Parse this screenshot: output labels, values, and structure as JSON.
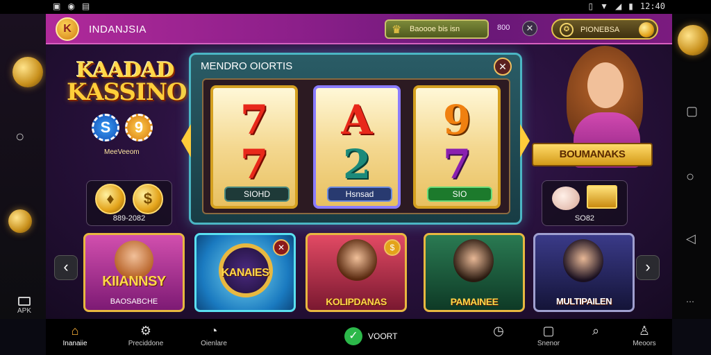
{
  "status_bar": {
    "left_icons": [
      "sim-icon",
      "whatsapp-icon",
      "gallery-icon"
    ],
    "right_icons": [
      "vibrate-icon",
      "wifi-icon",
      "signal-icon",
      "battery-icon"
    ],
    "time": "12:40"
  },
  "header": {
    "region": "INDANJSIA",
    "wallet_label": "Baoooe bis isn",
    "balance": "800",
    "promo_label": "PIONEBSA"
  },
  "brand": {
    "line1": "KAADAD",
    "line2": "KASSINO",
    "chip1": "S",
    "chip2": "9",
    "sub": "MeeVeeom"
  },
  "left_panel": {
    "value": "889-2082"
  },
  "right_panel": {
    "value": "SO82"
  },
  "slot": {
    "title": "MENDRO OIORTIS",
    "reels": [
      {
        "top": "7",
        "bottom": "7",
        "label": "SIOHD"
      },
      {
        "top": "A",
        "bottom": "2",
        "label": "Hsnsad"
      },
      {
        "top": "9",
        "bottom": "7",
        "label": "SIO"
      }
    ]
  },
  "bonus_banner": "BOUMANAKS",
  "games": [
    {
      "title": "KIIANNSY",
      "sub": "BAOSABCHE"
    },
    {
      "title": "KANAIES",
      "sub": ""
    },
    {
      "title": "KOLIPDANAS",
      "sub": ""
    },
    {
      "title": "PAMAINEE",
      "sub": ""
    },
    {
      "title": "MULTIPAILEN",
      "sub": ""
    }
  ],
  "bottom_nav": {
    "items": [
      {
        "label": "Inanaiie",
        "icon": "home-icon"
      },
      {
        "label": "Preciddone",
        "icon": "gear-icon"
      },
      {
        "label": "Oienlare",
        "icon": "timer-icon"
      },
      {
        "label": "",
        "icon": "clock-icon"
      },
      {
        "label": "Snenor",
        "icon": "square-icon"
      },
      {
        "label": "",
        "icon": "search-icon"
      },
      {
        "label": "Meoors",
        "icon": "user-icon"
      }
    ],
    "center_label": "VOORT"
  },
  "system": {
    "apk_label": "APK"
  },
  "colors": {
    "header": "#8c1f8a",
    "accent_gold": "#ffd84a",
    "slot_border": "#4bb6c4",
    "check_green": "#2cb84a"
  }
}
